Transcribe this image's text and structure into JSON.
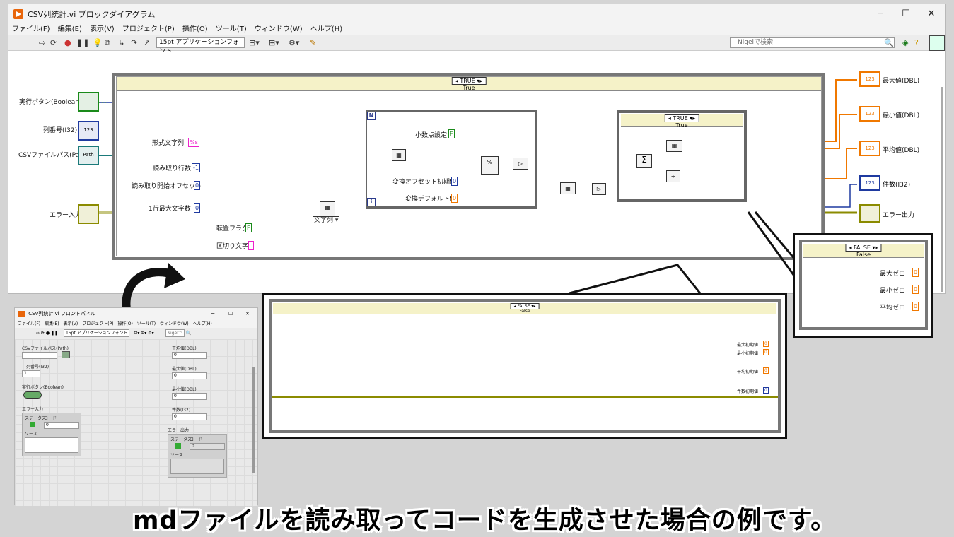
{
  "window": {
    "title": "CSV列統計.vi ブロックダイアグラム",
    "min": "─",
    "max": "☐",
    "close": "✕",
    "menu": [
      "ファイル(F)",
      "編集(E)",
      "表示(V)",
      "プロジェクト(P)",
      "操作(O)",
      "ツール(T)",
      "ウィンドウ(W)",
      "ヘルプ(H)"
    ],
    "font_dropdown": "15pt アプリケーションフォント",
    "search_placeholder": "Nigelで検索"
  },
  "diagram": {
    "outer_case_selector": "TRUE",
    "outer_case_title": "True",
    "inner_case_selector": "TRUE",
    "inner_case_title": "True",
    "controls": {
      "run_button": "実行ボタン(Boolean)",
      "column_num": "列番号(I32)",
      "csv_path": "CSVファイルパス(Path)",
      "error_in": "エラー入力"
    },
    "constants": {
      "format_string": "形式文字列",
      "format_string_val": "%s",
      "read_rows": "読み取り行数",
      "read_rows_val": "-1",
      "read_offset": "読み取り開始オフセット",
      "read_offset_val": "0",
      "max_chars": "1行最大文字数",
      "max_chars_val": "0",
      "transpose": "転置フラグ",
      "transpose_val": "F",
      "delimiter": "区切り文字",
      "string_type": "文字列",
      "decimal_point": "小数点設定",
      "decimal_point_val": "F",
      "conv_offset": "変換オフセット初期値",
      "conv_offset_val": "0",
      "conv_default": "変換デフォルト値",
      "conv_default_val": "0"
    },
    "indicators": {
      "max": "最大値(DBL)",
      "min": "最小値(DBL)",
      "avg": "平均値(DBL)",
      "count": "件数(I32)",
      "error_out": "エラー出力"
    }
  },
  "false_case_small": {
    "selector": "FALSE",
    "title": "False",
    "max_zero": "最大ゼロ",
    "min_zero": "最小ゼロ",
    "avg_zero": "平均ゼロ",
    "val": "0"
  },
  "false_case_large": {
    "selector": "FALSE",
    "title": "False",
    "max_init": "最大初期値",
    "min_init": "最小初期値",
    "avg_init": "平均初期値",
    "count_init": "件数初期値",
    "val": "0"
  },
  "front_panel": {
    "title": "CSV列統計.vi フロントパネル",
    "menu": [
      "ファイル(F)",
      "編集(E)",
      "表示(V)",
      "プロジェクト(P)",
      "操作(O)",
      "ツール(T)",
      "ウィンドウ(W)",
      "ヘルプ(H)"
    ],
    "font_dropdown": "15pt アプリケーションフォント",
    "search_placeholder": "Nigelで",
    "csv_path": "CSVファイルパス(Path)",
    "csv_path_val": "",
    "column": "列番号(I32)",
    "column_val": "1",
    "run_button": "実行ボタン(Boolean)",
    "error_in": "エラー入力",
    "status": "ステータス",
    "code": "コード",
    "code_val": "0",
    "source": "ソース",
    "avg": "平均値(DBL)",
    "avg_val": "0",
    "max": "最大値(DBL)",
    "max_val": "0",
    "min": "最小値(DBL)",
    "min_val": "0",
    "count": "件数(I32)",
    "count_val": "0",
    "error_out": "エラー出力",
    "status2": "ステータス",
    "code2": "コード",
    "code2_val": "0",
    "source2": "ソース"
  },
  "caption": "mdファイルを読み取ってコードを生成させた場合の例です。",
  "colors": {
    "wire_int": "#1f3aa0",
    "wire_dbl": "#f07800",
    "wire_string": "#ee22cc",
    "wire_path": "#1b7a7a",
    "wire_error": "#8b8b00",
    "wire_bool": "#1a8a1a"
  }
}
